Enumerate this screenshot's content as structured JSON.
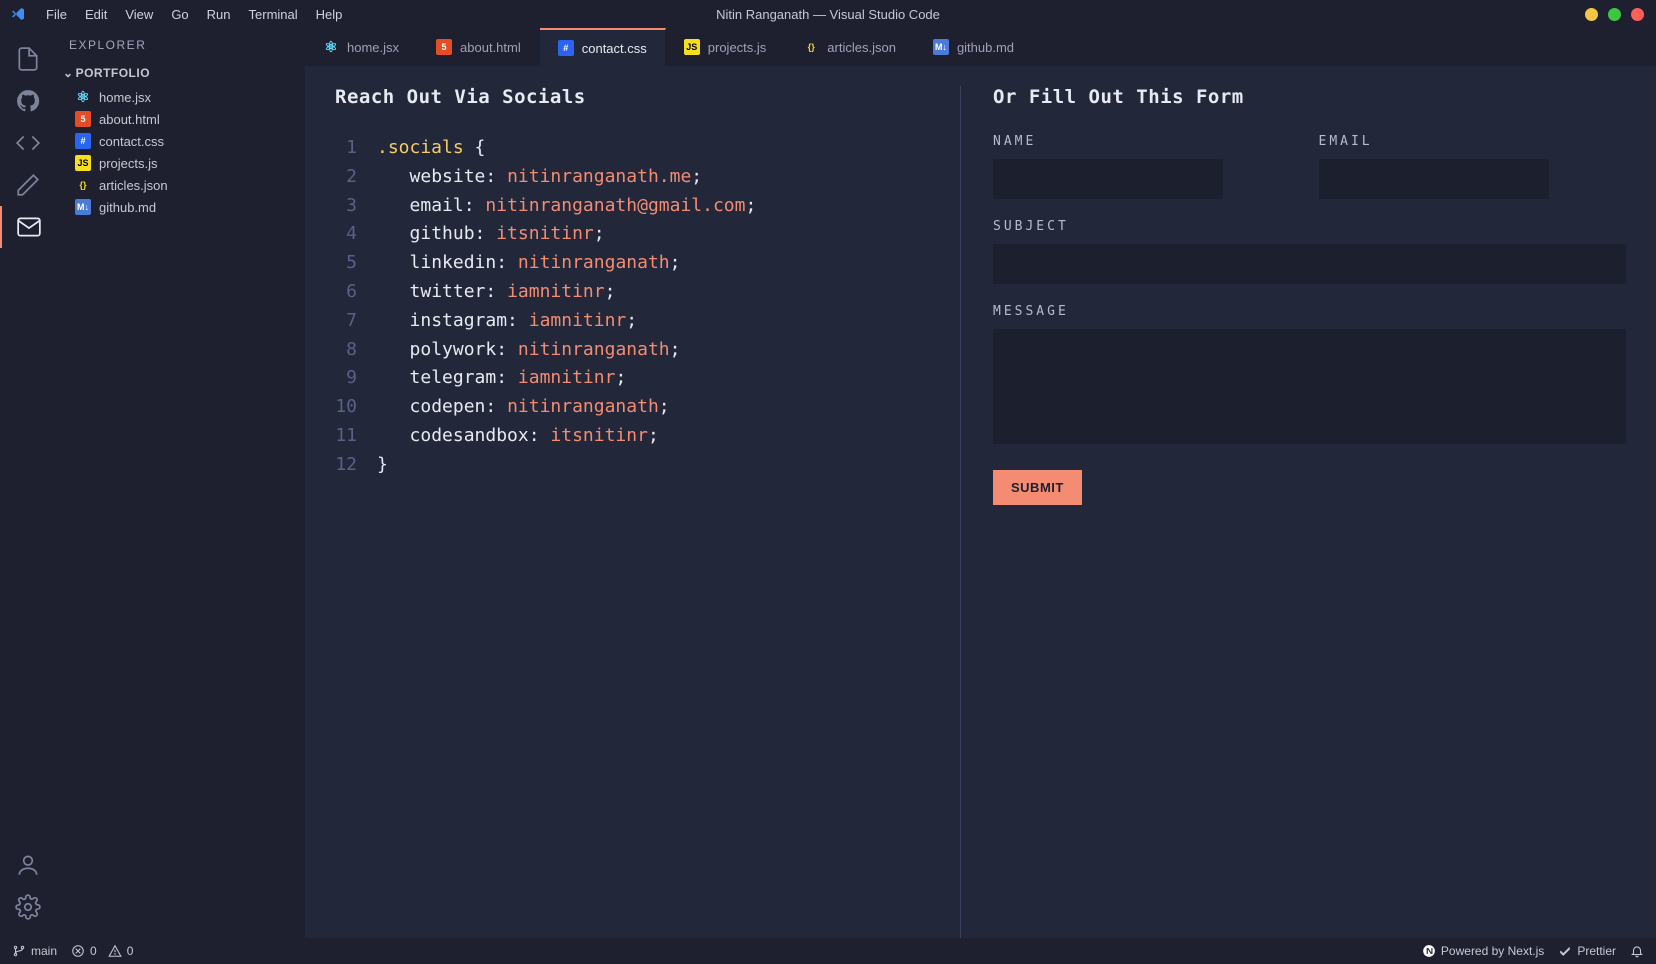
{
  "window_title": "Nitin Ranganath — Visual Studio Code",
  "menubar": [
    "File",
    "Edit",
    "View",
    "Go",
    "Run",
    "Terminal",
    "Help"
  ],
  "sidebar": {
    "title": "EXPLORER",
    "section": "PORTFOLIO",
    "files": [
      {
        "name": "home.jsx",
        "icon": "react"
      },
      {
        "name": "about.html",
        "icon": "html"
      },
      {
        "name": "contact.css",
        "icon": "css"
      },
      {
        "name": "projects.js",
        "icon": "js"
      },
      {
        "name": "articles.json",
        "icon": "json"
      },
      {
        "name": "github.md",
        "icon": "md"
      }
    ]
  },
  "tabs": [
    {
      "name": "home.jsx",
      "icon": "react",
      "active": false
    },
    {
      "name": "about.html",
      "icon": "html",
      "active": false
    },
    {
      "name": "contact.css",
      "icon": "css",
      "active": true
    },
    {
      "name": "projects.js",
      "icon": "js",
      "active": false
    },
    {
      "name": "articles.json",
      "icon": "json",
      "active": false
    },
    {
      "name": "github.md",
      "icon": "md",
      "active": false
    }
  ],
  "code": {
    "heading": "Reach Out Via Socials",
    "selector": ".socials",
    "lines": [
      {
        "prop": "website",
        "val": "nitinranganath.me"
      },
      {
        "prop": "email",
        "val": "nitinranganath@gmail.com"
      },
      {
        "prop": "github",
        "val": "itsnitinr"
      },
      {
        "prop": "linkedin",
        "val": "nitinranganath"
      },
      {
        "prop": "twitter",
        "val": "iamnitinr"
      },
      {
        "prop": "instagram",
        "val": "iamnitinr"
      },
      {
        "prop": "polywork",
        "val": "nitinranganath"
      },
      {
        "prop": "telegram",
        "val": "iamnitinr"
      },
      {
        "prop": "codepen",
        "val": "nitinranganath"
      },
      {
        "prop": "codesandbox",
        "val": "itsnitinr"
      }
    ]
  },
  "form": {
    "heading": "Or Fill Out This Form",
    "name_label": "NAME",
    "email_label": "EMAIL",
    "subject_label": "SUBJECT",
    "message_label": "MESSAGE",
    "submit_label": "SUBMIT"
  },
  "statusbar": {
    "branch": "main",
    "errors": "0",
    "warnings": "0",
    "powered": "Powered by Next.js",
    "prettier": "Prettier"
  },
  "icons": {
    "react": {
      "bg": "transparent",
      "fg": "#61dafb",
      "glyph": "⚛"
    },
    "html": {
      "bg": "#e44d26",
      "fg": "#fff",
      "glyph": "5"
    },
    "css": {
      "bg": "#2965f1",
      "fg": "#fff",
      "glyph": "#"
    },
    "js": {
      "bg": "#f7df1e",
      "fg": "#000",
      "glyph": "JS"
    },
    "json": {
      "bg": "transparent",
      "fg": "#f7df1e",
      "glyph": "{}"
    },
    "md": {
      "bg": "#4a7bd8",
      "fg": "#fff",
      "glyph": "M↓"
    }
  }
}
